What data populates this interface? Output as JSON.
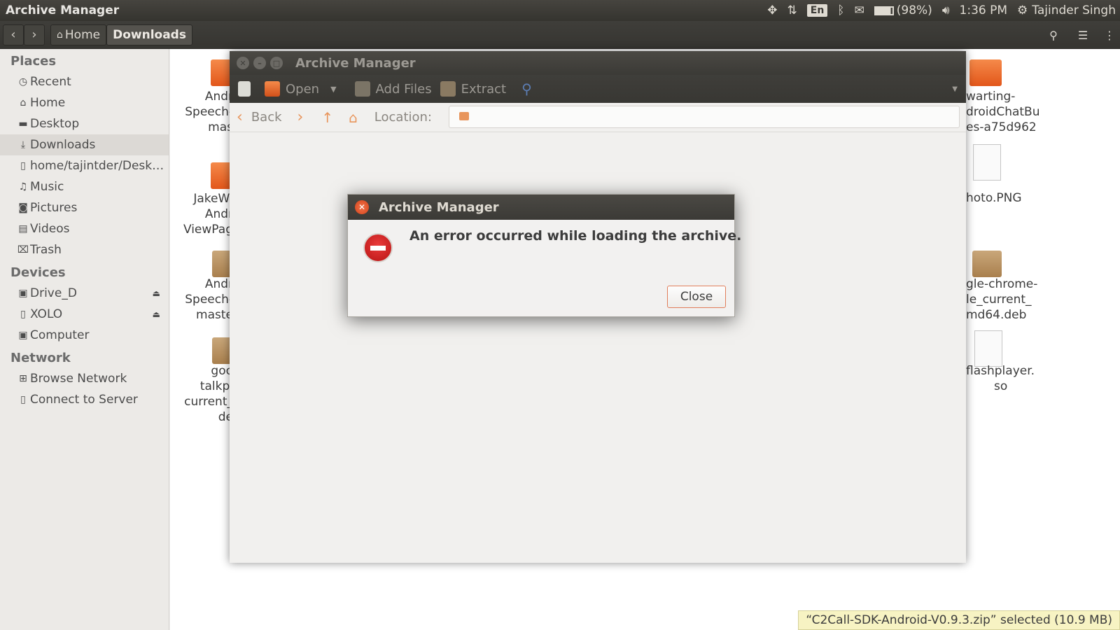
{
  "top_panel": {
    "app_title": "Archive Manager",
    "keyboard": "En",
    "battery": "(98%)",
    "time": "1:36 PM",
    "user": "Tajinder Singh"
  },
  "nav_toolbar": {
    "back_icon": "chevron-left-icon",
    "forward_icon": "chevron-right-icon",
    "crumbs": [
      "Home",
      "Downloads"
    ]
  },
  "sidebar": {
    "places_header": "Places",
    "places": [
      "Recent",
      "Home",
      "Desktop",
      "Downloads",
      "home/tajintder/Desk…",
      "Music",
      "Pictures",
      "Videos",
      "Trash"
    ],
    "devices_header": "Devices",
    "devices": [
      "Drive_D",
      "XOLO",
      "Computer"
    ],
    "network_header": "Network",
    "network": [
      "Browse Network",
      "Connect to Server"
    ]
  },
  "files_left": [
    {
      "l1": "Andr",
      "l2": "Speech-",
      "l3": "mas"
    },
    {
      "l1": "JakeWl",
      "l2": "Andr",
      "l3": "ViewPag"
    },
    {
      "l1": "Andr",
      "l2": "Speech-",
      "l3": "maste"
    },
    {
      "l1": "goo",
      "l2": "talkpl",
      "l3": "current_",
      "l4": "de"
    }
  ],
  "files_right": [
    {
      "l1": "warting-",
      "l2": "droidChatBu",
      "l3": "es-a75d962"
    },
    {
      "l1": "hoto.PNG"
    },
    {
      "l1": "gle-chrome-",
      "l2": "le_current_",
      "l3": "md64.deb"
    },
    {
      "l1": "flashplayer.",
      "l2": "so"
    }
  ],
  "archive_window": {
    "title": "Archive Manager",
    "open_label": "Open",
    "add_files_label": "Add Files",
    "extract_label": "Extract",
    "back_label": "Back",
    "location_label": "Location:"
  },
  "dialog": {
    "title": "Archive Manager",
    "message": "An error occurred while loading the archive.",
    "close_label": "Close"
  },
  "status_bar": {
    "text": "“C2Call-SDK-Android-V0.9.3.zip” selected (10.9 MB)"
  }
}
